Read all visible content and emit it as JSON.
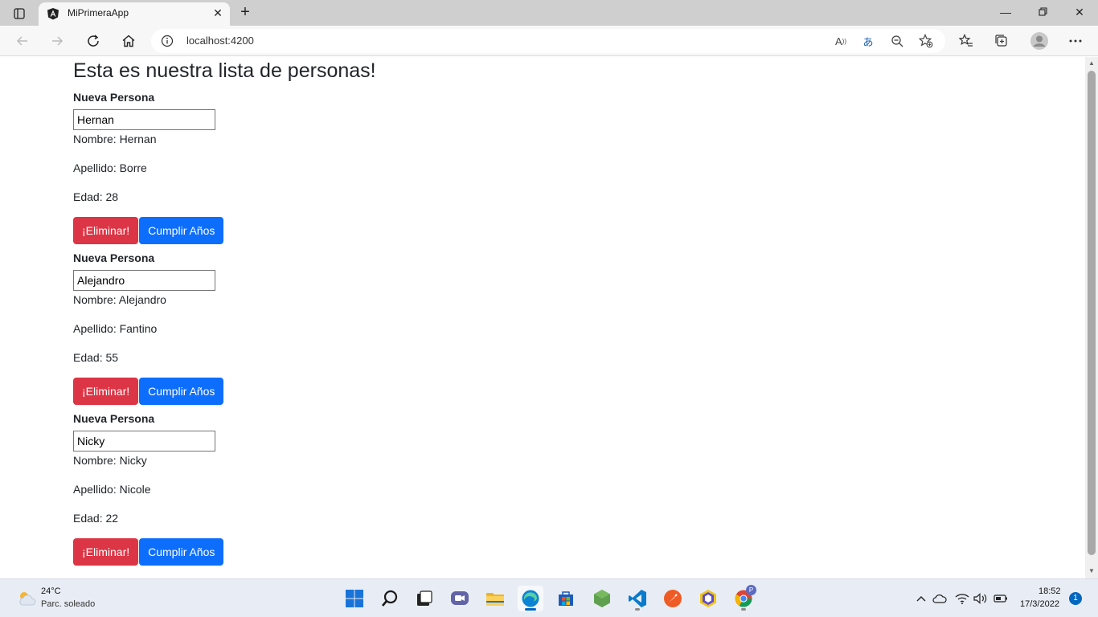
{
  "browser": {
    "tab_title": "MiPrimeraApp",
    "url": "localhost:4200"
  },
  "page": {
    "title": "Esta es nuestra lista de personas!",
    "personas": [
      {
        "heading": "Nueva Persona",
        "input_value": "Hernan",
        "nombre": "Nombre: Hernan",
        "apellido": "Apellido: Borre",
        "edad": "Edad: 28",
        "delete_label": "¡Eliminar!",
        "birthday_label": "Cumplir Años"
      },
      {
        "heading": "Nueva Persona",
        "input_value": "Alejandro",
        "nombre": "Nombre: Alejandro",
        "apellido": "Apellido: Fantino",
        "edad": "Edad: 55",
        "delete_label": "¡Eliminar!",
        "birthday_label": "Cumplir Años"
      },
      {
        "heading": "Nueva Persona",
        "input_value": "Nicky",
        "nombre": "Nombre: Nicky",
        "apellido": "Apellido: Nicole",
        "edad": "Edad: 22",
        "delete_label": "¡Eliminar!",
        "birthday_label": "Cumplir Años"
      }
    ]
  },
  "taskbar": {
    "weather_temp": "24°C",
    "weather_desc": "Parc. soleado",
    "time": "18:52",
    "date": "17/3/2022",
    "notifications": "1",
    "chrome_badge": "P"
  },
  "colors": {
    "danger": "#dc3545",
    "primary": "#0d6efd"
  }
}
